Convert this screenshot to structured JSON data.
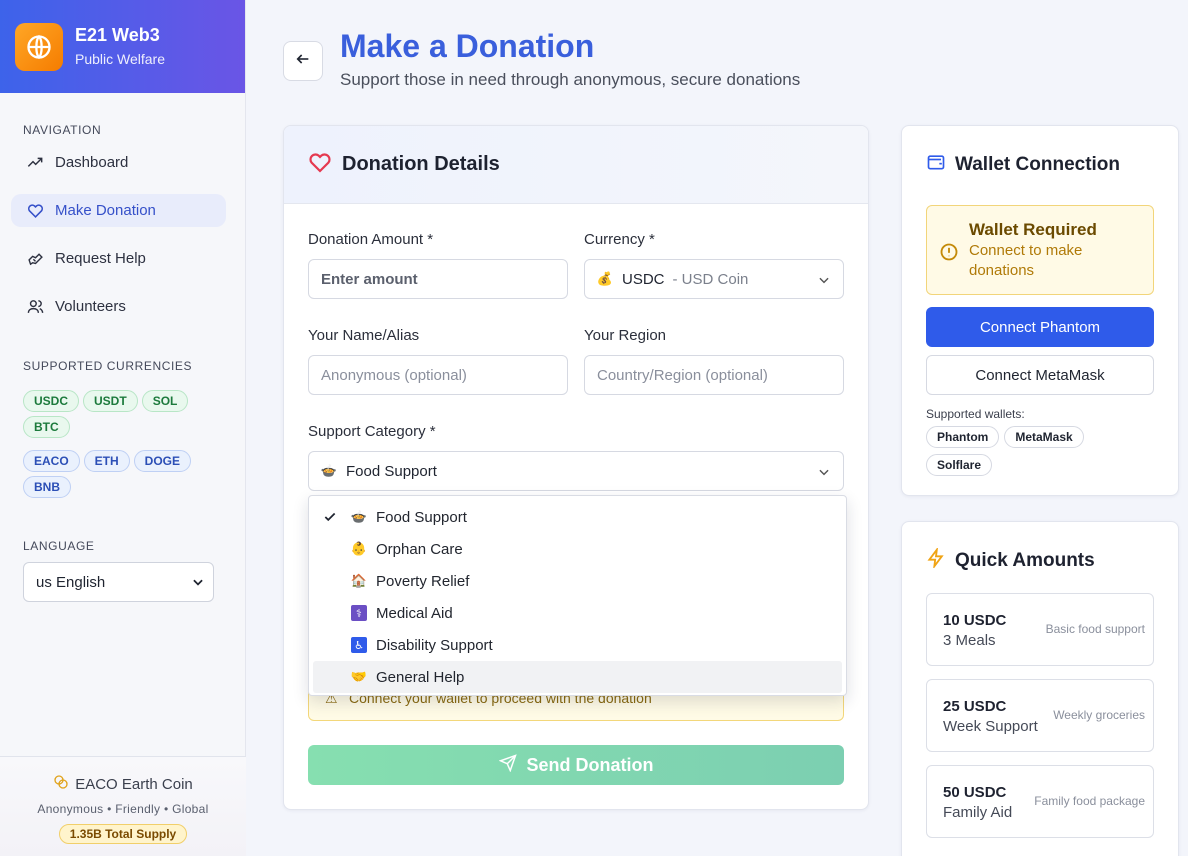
{
  "brand": {
    "title": "E21 Web3",
    "subtitle": "Public Welfare"
  },
  "sidebar": {
    "nav_label": "NAVIGATION",
    "nav": [
      {
        "label": "Dashboard",
        "icon": "trending-up-icon"
      },
      {
        "label": "Make Donation",
        "icon": "heart-icon",
        "active": true
      },
      {
        "label": "Request Help",
        "icon": "helping-hand-icon"
      },
      {
        "label": "Volunteers",
        "icon": "users-icon"
      }
    ],
    "currencies_label": "SUPPORTED CURRENCIES",
    "currencies_green": [
      "USDC",
      "USDT",
      "SOL",
      "BTC"
    ],
    "currencies_blue": [
      "EACO",
      "ETH",
      "DOGE",
      "BNB"
    ],
    "language_label": "LANGUAGE",
    "language_value": "us English",
    "footer": {
      "coin": "EACO Earth Coin",
      "tagline": "Anonymous • Friendly • Global",
      "supply": "1.35B Total Supply"
    }
  },
  "header": {
    "title": "Make a Donation",
    "subtitle": "Support those in need through anonymous, secure donations"
  },
  "form": {
    "title": "Donation Details",
    "amount_label": "Donation Amount *",
    "amount_placeholder": "Enter amount",
    "currency_label": "Currency *",
    "currency_symbol": "USDC",
    "currency_name": "- USD Coin",
    "name_label": "Your Name/Alias",
    "name_placeholder": "Anonymous (optional)",
    "region_label": "Your Region",
    "region_placeholder": "Country/Region (optional)",
    "category_label": "Support Category *",
    "category_value": "Food Support",
    "category_options": [
      {
        "label": "Food Support",
        "emoji": "🍲",
        "selected": true
      },
      {
        "label": "Orphan Care",
        "emoji": "👶"
      },
      {
        "label": "Poverty Relief",
        "emoji": "🏠"
      },
      {
        "label": "Medical Aid",
        "emoji": "⚕"
      },
      {
        "label": "Disability Support",
        "emoji": "♿"
      },
      {
        "label": "General Help",
        "emoji": "🤝",
        "hover": true
      }
    ],
    "warning": "Connect your wallet to proceed with the donation",
    "send_label": "Send Donation"
  },
  "wallet": {
    "title": "Wallet Connection",
    "notice_title": "Wallet Required",
    "notice_text": "Connect to make donations",
    "connect_phantom": "Connect Phantom",
    "connect_metamask": "Connect MetaMask",
    "supported_label": "Supported wallets:",
    "supported": [
      "Phantom",
      "MetaMask",
      "Solflare"
    ]
  },
  "quick": {
    "title": "Quick Amounts",
    "items": [
      {
        "amount": "10 USDC",
        "label": "3 Meals",
        "desc": "Basic food support"
      },
      {
        "amount": "25 USDC",
        "label": "Week Support",
        "desc": "Weekly groceries"
      },
      {
        "amount": "50 USDC",
        "label": "Family Aid",
        "desc": "Family food package"
      }
    ]
  },
  "colors": {
    "primary": "#2f5bea",
    "brand_gradient_start": "#3d63ea",
    "brand_gradient_end": "#6a55e6",
    "heart": "#e53950",
    "send_button": "#86dfb0"
  }
}
